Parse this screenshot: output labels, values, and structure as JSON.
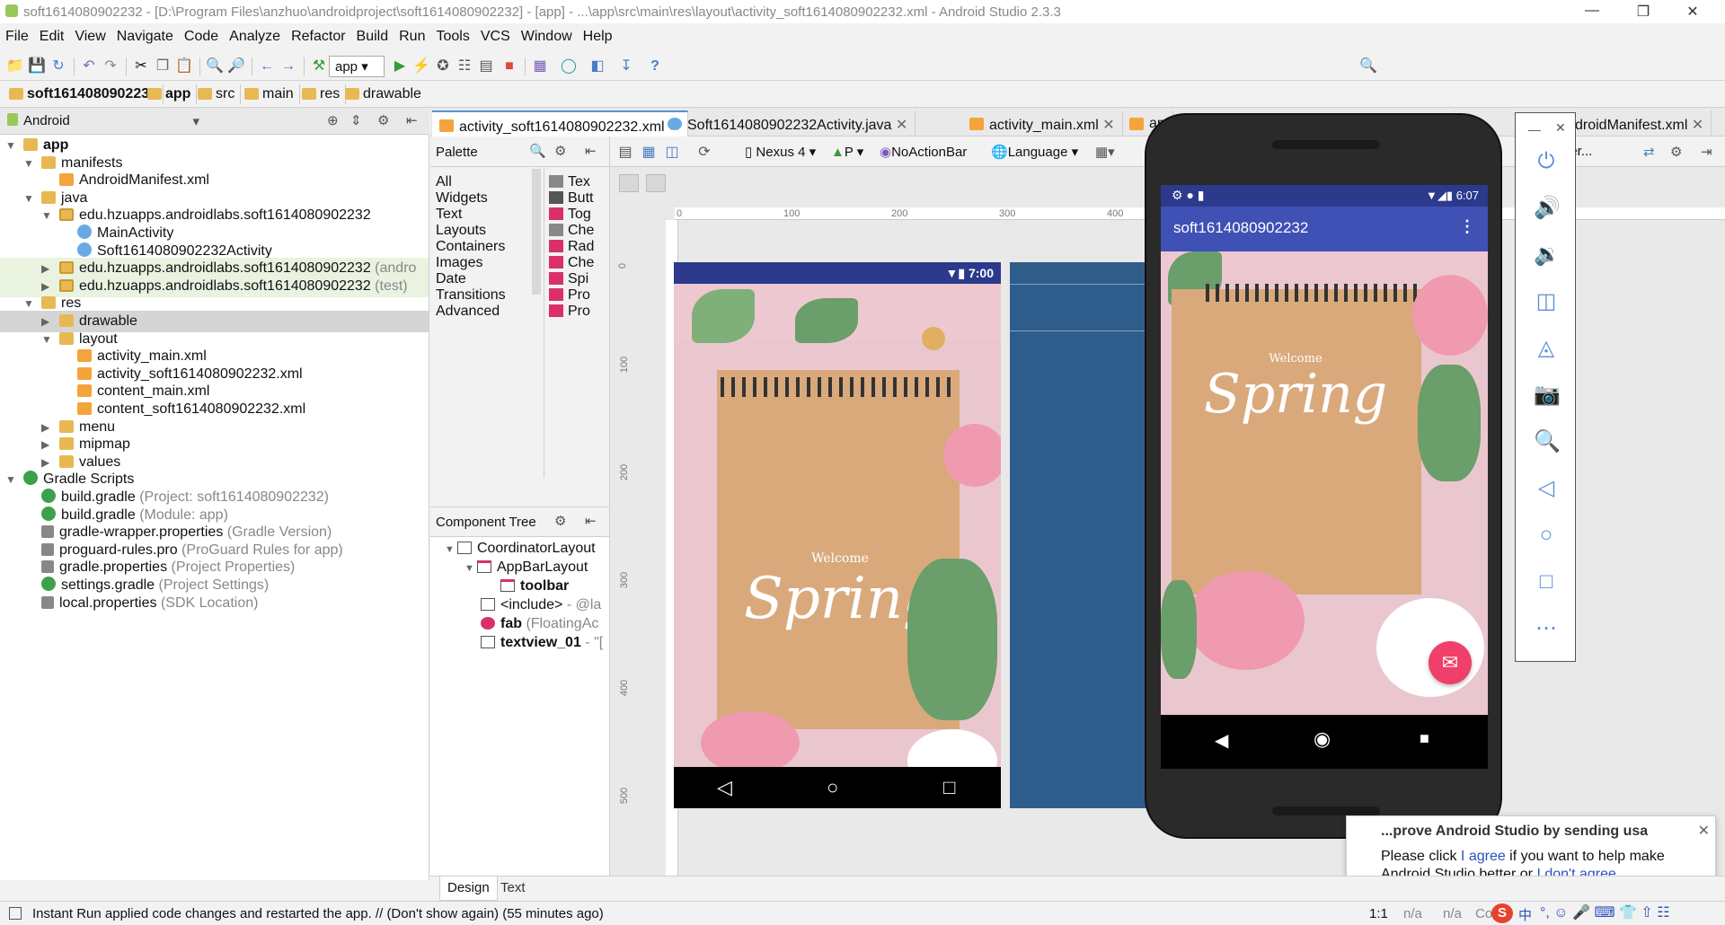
{
  "window": {
    "title": "soft1614080902232 - [D:\\Program Files\\anzhuo\\androidproject\\soft1614080902232] - [app] - ...\\app\\src\\main\\res\\layout\\activity_soft1614080902232.xml - Android Studio 2.3.3"
  },
  "menu": [
    "File",
    "Edit",
    "View",
    "Navigate",
    "Code",
    "Analyze",
    "Refactor",
    "Build",
    "Run",
    "Tools",
    "VCS",
    "Window",
    "Help"
  ],
  "toolbar": {
    "run_config": "app",
    "help": "?"
  },
  "breadcrumbs": [
    "soft1614080902232",
    "app",
    "src",
    "main",
    "res",
    "drawable"
  ],
  "project_panel": {
    "view_selector": "Android",
    "tree": [
      {
        "label": "app",
        "level": 0,
        "icon": "module-icon",
        "bold": true
      },
      {
        "label": "manifests",
        "level": 1,
        "icon": "folder-icon"
      },
      {
        "label": "AndroidManifest.xml",
        "level": 2,
        "icon": "xml-icon"
      },
      {
        "label": "java",
        "level": 1,
        "icon": "folder-icon"
      },
      {
        "label": "edu.hzuapps.androidlabs.soft1614080902232",
        "level": 2,
        "icon": "package-icon"
      },
      {
        "label": "MainActivity",
        "level": 3,
        "icon": "class-icon"
      },
      {
        "label": "Soft1614080902232Activity",
        "level": 3,
        "icon": "class-icon"
      },
      {
        "label": "edu.hzuapps.androidlabs.soft1614080902232",
        "hint": "(andro",
        "level": 2,
        "icon": "package-icon"
      },
      {
        "label": "edu.hzuapps.androidlabs.soft1614080902232",
        "hint": "(test)",
        "level": 2,
        "icon": "package-icon"
      },
      {
        "label": "res",
        "level": 1,
        "icon": "folder-icon"
      },
      {
        "label": "drawable",
        "level": 2,
        "icon": "folder-icon"
      },
      {
        "label": "layout",
        "level": 2,
        "icon": "folder-icon"
      },
      {
        "label": "activity_main.xml",
        "level": 3,
        "icon": "xml-icon"
      },
      {
        "label": "activity_soft1614080902232.xml",
        "level": 3,
        "icon": "xml-icon"
      },
      {
        "label": "content_main.xml",
        "level": 3,
        "icon": "xml-icon"
      },
      {
        "label": "content_soft1614080902232.xml",
        "level": 3,
        "icon": "xml-icon"
      },
      {
        "label": "menu",
        "level": 2,
        "icon": "folder-icon"
      },
      {
        "label": "mipmap",
        "level": 2,
        "icon": "folder-icon"
      },
      {
        "label": "values",
        "level": 2,
        "icon": "folder-icon"
      },
      {
        "label": "Gradle Scripts",
        "level": 0,
        "icon": "gradle-icon"
      },
      {
        "label": "build.gradle",
        "hint": "(Project: soft1614080902232)",
        "level": 1,
        "icon": "gradle-icon"
      },
      {
        "label": "build.gradle",
        "hint": "(Module: app)",
        "level": 1,
        "icon": "gradle-icon"
      },
      {
        "label": "gradle-wrapper.properties",
        "hint": "(Gradle Version)",
        "level": 1,
        "icon": "properties-icon"
      },
      {
        "label": "proguard-rules.pro",
        "hint": "(ProGuard Rules for app)",
        "level": 1,
        "icon": "properties-icon"
      },
      {
        "label": "gradle.properties",
        "hint": "(Project Properties)",
        "level": 1,
        "icon": "properties-icon"
      },
      {
        "label": "settings.gradle",
        "hint": "(Project Settings)",
        "level": 1,
        "icon": "gradle-icon"
      },
      {
        "label": "local.properties",
        "hint": "(SDK Location)",
        "level": 1,
        "icon": "properties-icon"
      }
    ]
  },
  "editor_tabs": [
    "activity_soft1614080902232.xml",
    "Soft1614080902232Activity.java",
    "activity_main.xml",
    "ap",
    "xml",
    "droidManifest.xml"
  ],
  "palette": {
    "title": "Palette",
    "categories": [
      "All",
      "Widgets",
      "Text",
      "Layouts",
      "Containers",
      "Images",
      "Date",
      "Transitions",
      "Advanced"
    ],
    "items": [
      "Tex",
      "Butt",
      "Tog",
      "Che",
      "Rad",
      "Che",
      "Spi",
      "Pro",
      "Pro"
    ]
  },
  "component_tree": {
    "title": "Component Tree",
    "nodes": [
      {
        "label": "CoordinatorLayout",
        "hint": ""
      },
      {
        "label": "AppBarLayout",
        "hint": ""
      },
      {
        "label": "toolbar",
        "hint": ""
      },
      {
        "label": "<include>",
        "hint": "- @la"
      },
      {
        "label": "fab",
        "hint": "(FloatingAc"
      },
      {
        "label": "textview_01",
        "hint": "- \"["
      }
    ]
  },
  "design_toolbar": {
    "device": "Nexus 4",
    "api": "P",
    "theme": "NoActionBar",
    "language": "Language",
    "other": "per..."
  },
  "ruler": {
    "h": [
      "0",
      "100",
      "200",
      "300",
      "400"
    ],
    "v": [
      "0",
      "100",
      "200",
      "300",
      "400",
      "500"
    ]
  },
  "design_phone": {
    "time": "7:00",
    "welcome": "Welcome",
    "spring": "Spring"
  },
  "emulator": {
    "time": "6:07",
    "app_title": "soft1614080902232",
    "welcome": "Welcome",
    "spring": "Spring",
    "side_buttons": [
      "power-icon",
      "volume-up-icon",
      "volume-down-icon",
      "rotate-left-icon",
      "rotate-right-icon",
      "camera-icon",
      "zoom-icon",
      "back-icon",
      "home-icon",
      "overview-icon",
      "more-icon"
    ]
  },
  "bottom_tabs": [
    "Design",
    "Text"
  ],
  "notification": {
    "title": "...prove Android Studio by sending usa",
    "line1": "Please click ",
    "agree": "I agree",
    "line1b": " if you want to help make",
    "line2": "Android Studio better or ",
    "dont": "I don't agree",
    "ellipsis": "..."
  },
  "status": {
    "message": "Instant Run applied code changes and restarted the app. // (Don't show again) (55 minutes ago)",
    "pos": "1:1",
    "na1": "n/a",
    "na2": "n/a",
    "co": "Co",
    "ime": "中"
  }
}
